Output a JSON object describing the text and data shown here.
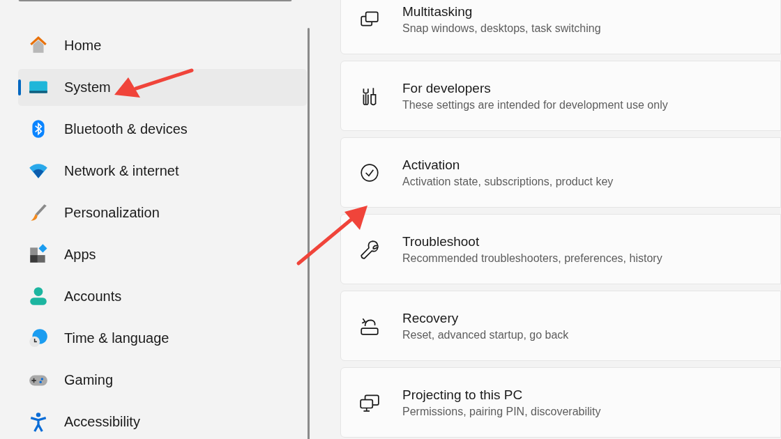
{
  "sidebar": {
    "items": [
      {
        "label": "Home",
        "selected": false
      },
      {
        "label": "System",
        "selected": true
      },
      {
        "label": "Bluetooth & devices",
        "selected": false
      },
      {
        "label": "Network & internet",
        "selected": false
      },
      {
        "label": "Personalization",
        "selected": false
      },
      {
        "label": "Apps",
        "selected": false
      },
      {
        "label": "Accounts",
        "selected": false
      },
      {
        "label": "Time & language",
        "selected": false
      },
      {
        "label": "Gaming",
        "selected": false
      },
      {
        "label": "Accessibility",
        "selected": false
      }
    ]
  },
  "settings": [
    {
      "title": "Multitasking",
      "subtitle": "Snap windows, desktops, task switching"
    },
    {
      "title": "For developers",
      "subtitle": "These settings are intended for development use only"
    },
    {
      "title": "Activation",
      "subtitle": "Activation state, subscriptions, product key"
    },
    {
      "title": "Troubleshoot",
      "subtitle": "Recommended troubleshooters, preferences, history"
    },
    {
      "title": "Recovery",
      "subtitle": "Reset, advanced startup, go back"
    },
    {
      "title": "Projecting to this PC",
      "subtitle": "Permissions, pairing PIN, discoverability"
    }
  ]
}
